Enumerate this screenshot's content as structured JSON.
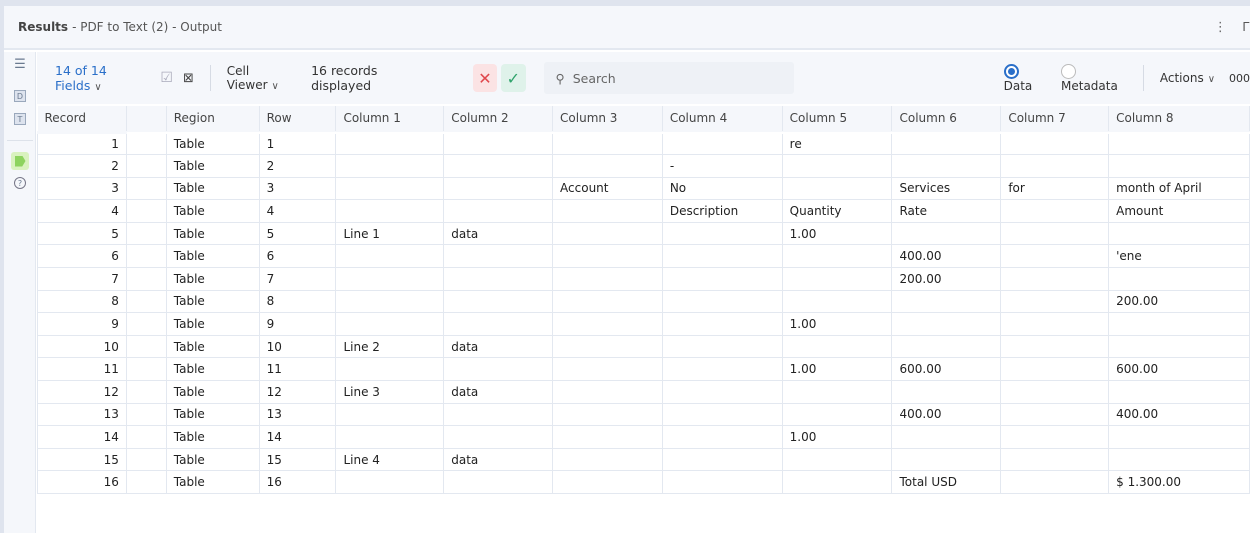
{
  "header": {
    "title_bold": "Results",
    "title_rest": "- PDF to Text (2) - Output",
    "more": "⋮",
    "pin": "📌"
  },
  "sidebar": {
    "icons": [
      "list-icon",
      "d-icon",
      "t-icon",
      "tag-icon",
      "help-icon"
    ],
    "d": "D",
    "t": "T",
    "help": "?"
  },
  "toolbar": {
    "fields": "14 of 14 Fields",
    "cell_viewer": "Cell Viewer",
    "records": "16 records displayed",
    "search_placeholder": "Search",
    "data": "Data",
    "metadata": "Metadata",
    "actions": "Actions",
    "extra": "000",
    "colors": {
      "reject_bg": "#fbe3e4",
      "accept_bg": "#dff2ea"
    }
  },
  "columns": [
    "Record",
    "",
    "Region",
    "Row",
    "Column 1",
    "Column 2",
    "Column 3",
    "Column 4",
    "Column 5",
    "Column 6",
    "Column 7",
    "Column 8"
  ],
  "rows": [
    [
      "1",
      "",
      "Table",
      "1",
      "",
      "",
      "",
      "",
      "re",
      "",
      "",
      ""
    ],
    [
      "2",
      "",
      "Table",
      "2",
      "",
      "",
      "",
      "-",
      "",
      "",
      "",
      ""
    ],
    [
      "3",
      "",
      "Table",
      "3",
      "",
      "",
      "Account",
      "No",
      "",
      "Services",
      "for",
      "month of April"
    ],
    [
      "4",
      "",
      "Table",
      "4",
      "",
      "",
      "",
      "Description",
      "Quantity",
      "Rate",
      "",
      "Amount"
    ],
    [
      "5",
      "",
      "Table",
      "5",
      "Line 1",
      "data",
      "",
      "",
      "1.00",
      "",
      "",
      ""
    ],
    [
      "6",
      "",
      "Table",
      "6",
      "",
      "",
      "",
      "",
      "",
      "400.00",
      "",
      "'ene"
    ],
    [
      "7",
      "",
      "Table",
      "7",
      "",
      "",
      "",
      "",
      "",
      "200.00",
      "",
      ""
    ],
    [
      "8",
      "",
      "Table",
      "8",
      "",
      "",
      "",
      "",
      "",
      "",
      "",
      "200.00"
    ],
    [
      "9",
      "",
      "Table",
      "9",
      "",
      "",
      "",
      "",
      "1.00",
      "",
      "",
      ""
    ],
    [
      "10",
      "",
      "Table",
      "10",
      "Line 2",
      "data",
      "",
      "",
      "",
      "",
      "",
      ""
    ],
    [
      "11",
      "",
      "Table",
      "11",
      "",
      "",
      "",
      "",
      "1.00",
      "600.00",
      "",
      "600.00"
    ],
    [
      "12",
      "",
      "Table",
      "12",
      "Line 3",
      "data",
      "",
      "",
      "",
      "",
      "",
      ""
    ],
    [
      "13",
      "",
      "Table",
      "13",
      "",
      "",
      "",
      "",
      "",
      "400.00",
      "",
      "400.00"
    ],
    [
      "14",
      "",
      "Table",
      "14",
      "",
      "",
      "",
      "",
      "1.00",
      "",
      "",
      ""
    ],
    [
      "15",
      "",
      "Table",
      "15",
      "Line 4",
      "data",
      "",
      "",
      "",
      "",
      "",
      ""
    ],
    [
      "16",
      "",
      "Table",
      "16",
      "",
      "",
      "",
      "",
      "",
      "Total USD",
      "",
      "$ 1.300.00"
    ]
  ]
}
